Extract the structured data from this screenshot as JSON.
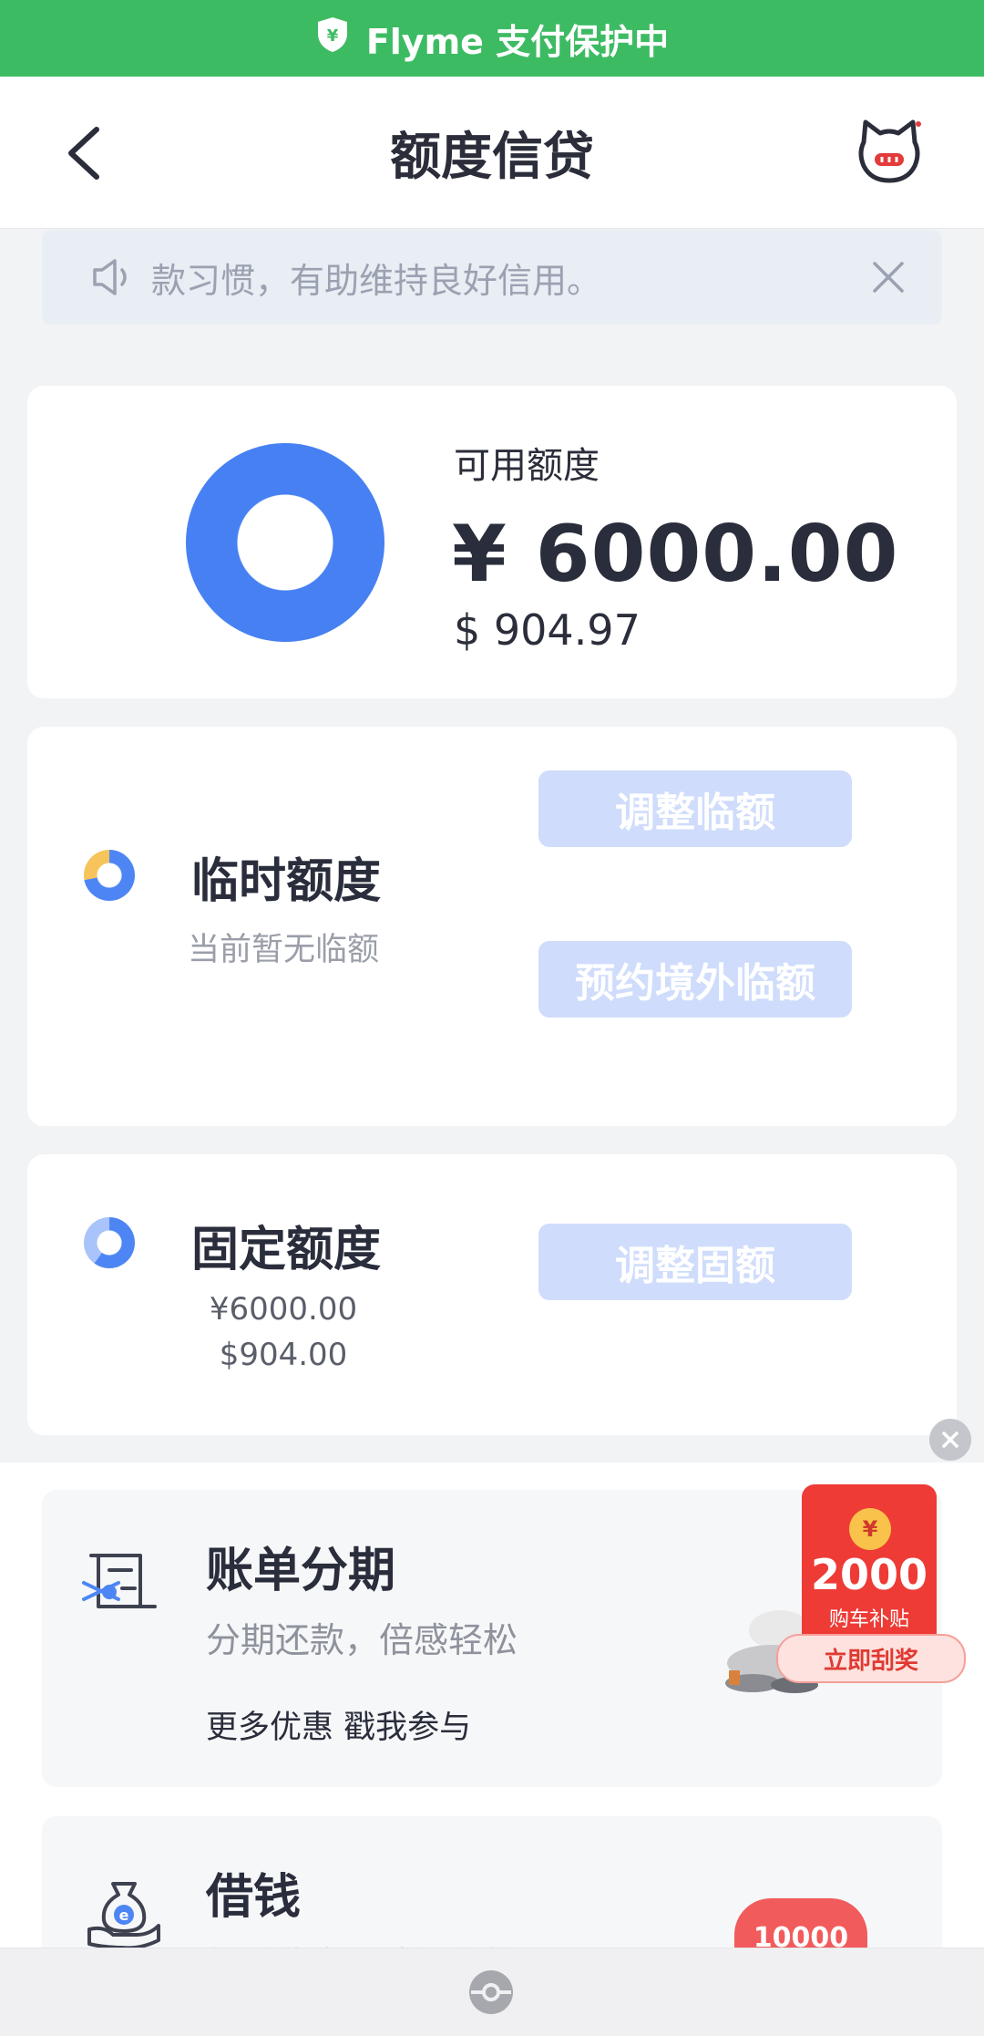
{
  "banner": {
    "text": "Flyme 支付保护中",
    "icon": "shield-yuan-icon"
  },
  "header": {
    "title": "额度信贷",
    "back_icon": "chevron-left-icon",
    "right_icon": "cat-mascot-icon"
  },
  "notice": {
    "text": "款习惯，有助维持良好信用。",
    "icon": "speaker-icon",
    "close_icon": "close-icon"
  },
  "available": {
    "label": "可用额度",
    "amount": "¥ 6000.00",
    "usd": "$ 904.97"
  },
  "temporary": {
    "title": "临时额度",
    "subtitle": "当前暂无临额",
    "adjust_button": "调整临额",
    "overseas_button": "预约境外临额"
  },
  "fixed": {
    "title": "固定额度",
    "cny": "¥6000.00",
    "usd": "$904.00",
    "adjust_button": "调整固额"
  },
  "services": {
    "bill": {
      "title": "账单分期",
      "subtitle": "分期还款，倍感轻松",
      "promo": "更多优惠 戳我参与"
    },
    "loan": {
      "title": "借钱",
      "subtitle": "极低费率，秒级放款",
      "badge": "10000"
    }
  },
  "promo_packet": {
    "coin": "¥",
    "amount": "2000",
    "label": "购车补贴",
    "button": "立即刮奖"
  },
  "colors": {
    "accent_green": "#3dbb63",
    "ring_blue": "#4680f3",
    "button_disabled": "#cfdcfb",
    "packet_red": "#ee3b36"
  }
}
